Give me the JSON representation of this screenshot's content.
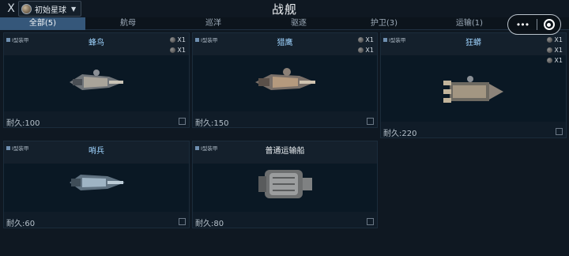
{
  "header": {
    "close_label": "X",
    "planet_label": "初始星球",
    "title": "战舰",
    "capsule_menu": "•••",
    "capsule_menu_icon": "more-dots-icon",
    "capsule_close_icon": "target-icon"
  },
  "tabs": [
    {
      "label": "全部(5)",
      "active": true
    },
    {
      "label": "航母"
    },
    {
      "label": "巡洋"
    },
    {
      "label": "驱逐"
    },
    {
      "label": "护卫(3)"
    },
    {
      "label": "运输(1)"
    }
  ],
  "ships": [
    {
      "name": "蜂鸟",
      "armor": "I型装甲",
      "slots": [
        "X1",
        "X1"
      ],
      "durability": "耐久:100"
    },
    {
      "name": "猎鹰",
      "armor": "I型装甲",
      "slots": [
        "X1",
        "X1"
      ],
      "durability": "耐久:150"
    },
    {
      "name": "狂蟒",
      "armor": "I型装甲",
      "slots": [
        "X1",
        "X1",
        "X1"
      ],
      "durability": "耐久:220"
    },
    {
      "name": "哨兵",
      "armor": "I型装甲",
      "slots": [],
      "durability": "耐久:60"
    },
    {
      "name": "普通运输船",
      "armor": "I型装甲",
      "slots": [],
      "durability": "耐久:80"
    }
  ],
  "colors": {
    "active_tab": "#35577a",
    "name_blue": "#9fd4ff",
    "background": "#0f1822"
  }
}
